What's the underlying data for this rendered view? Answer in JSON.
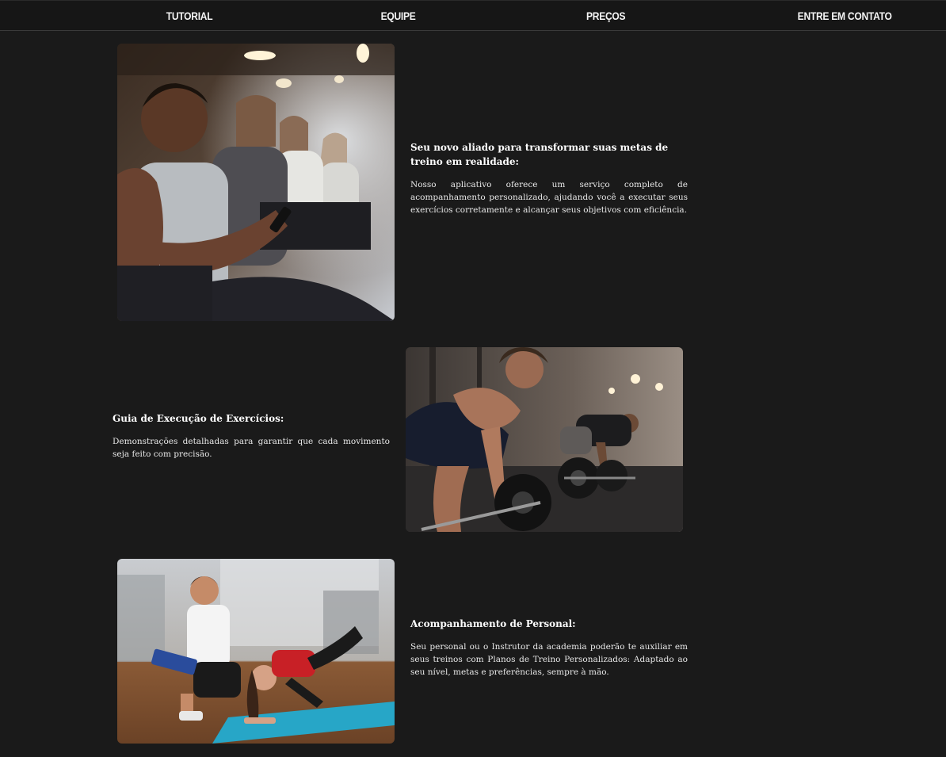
{
  "nav": {
    "items": [
      {
        "label": "TUTORIAL"
      },
      {
        "label": "EQUIPE"
      },
      {
        "label": "PREÇOS"
      },
      {
        "label": "ENTRE EM CONTATO"
      }
    ]
  },
  "sections": [
    {
      "title": "Seu novo aliado para transformar suas metas de treino em realidade:",
      "body": "Nosso aplicativo oferece um serviço completo de acompanhamento personalizado, ajudando você a executar seus exercícios corretamente e alcançar seus objetivos com eficiência.",
      "image": "photo of people seated in a gym using smartphones"
    },
    {
      "title": "Guia de Execução de Exercícios:",
      "body": "Demonstrações detalhadas para garantir que cada movimento seja feito com precisão.",
      "image": "photo of a woman and a man lifting barbells in a gym"
    },
    {
      "title": "Acompanhamento de Personal:",
      "body": "Seu personal ou o Instrutor da academia poderão te auxiliar em seus treinos com Planos de Treino Personalizados: Adaptado ao seu nível, metas e preferências, sempre à mão.",
      "image": "photo of a personal trainer guiding a woman exercising on a mat"
    }
  ]
}
